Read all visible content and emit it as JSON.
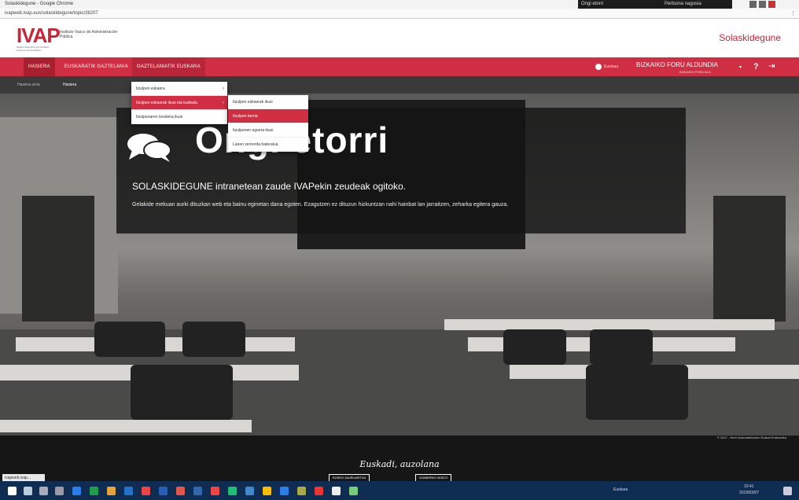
{
  "browser": {
    "tab_title": "Solaskidegune - Google Chrome",
    "url": "ivapweb.ivap.eus/solaskidegune/topic/26207",
    "user_label": "Ongi etorri",
    "window_label": "Pertsona nagusia"
  },
  "header": {
    "logo": "IVAP",
    "logo_sub": "HERRI ARDURALARITZAREN EUSKAL ERAKUNDEA",
    "logo_desc": "Instituto Vasco de Administración Pública",
    "site_name": "Solaskidegune"
  },
  "nav": {
    "home": "HASIERA",
    "item2": "EUSKARATIK GAZTELANIA",
    "item3": "GAZTELANIATIK EUSKARA",
    "lang": "Euskara",
    "user_name": "BIZKAIKO FORU ALDUNDIA",
    "user_org": "BIZKAIKO FORU ALD."
  },
  "breadcrumb": {
    "home": "Hasiera orria",
    "current": "Hasiera"
  },
  "hero": {
    "title": "Ongi etorri",
    "subtitle": "SOLASKIDEGUNE intranetean zaude IVAPekin zeudeak ogitoko.",
    "text": "Gelakide mekuan aurki dituzkan web eta bainu eginetan dana egoten. Ezagutzen ez dituzun hizkuntzan nahi hainbat lan jarraitzen, zeharka egitera gauza."
  },
  "dropdown1": [
    {
      "label": "Itzulpen eskaera",
      "arrow": "›"
    },
    {
      "label": "Itzulpen eskaerak ikusi eta kudeatu",
      "arrow": "›"
    },
    {
      "label": "Itzulpenaren txostena ikusi",
      "arrow": ""
    }
  ],
  "dropdown2": [
    {
      "label": "Itzulpen eskaerak ikusi"
    },
    {
      "label": "Itzulpen berria"
    },
    {
      "label": "Itzulpenen egoera ikusi"
    },
    {
      "label": "Lanen zerrenda bateratua"
    }
  ],
  "copyright": "© 2017 - Herri Arduralaritzaren Euskal Erakundea",
  "footer": {
    "title": "Euskadi, auzolana",
    "btn1": "EUSKO JAURLARITZA",
    "btn2": "GOBIERNO VASCO"
  },
  "status_tip": "ivapweb.ivap...",
  "taskbar": {
    "time": "10:41",
    "date": "2019/03/07",
    "tray_text": "Euskara"
  }
}
